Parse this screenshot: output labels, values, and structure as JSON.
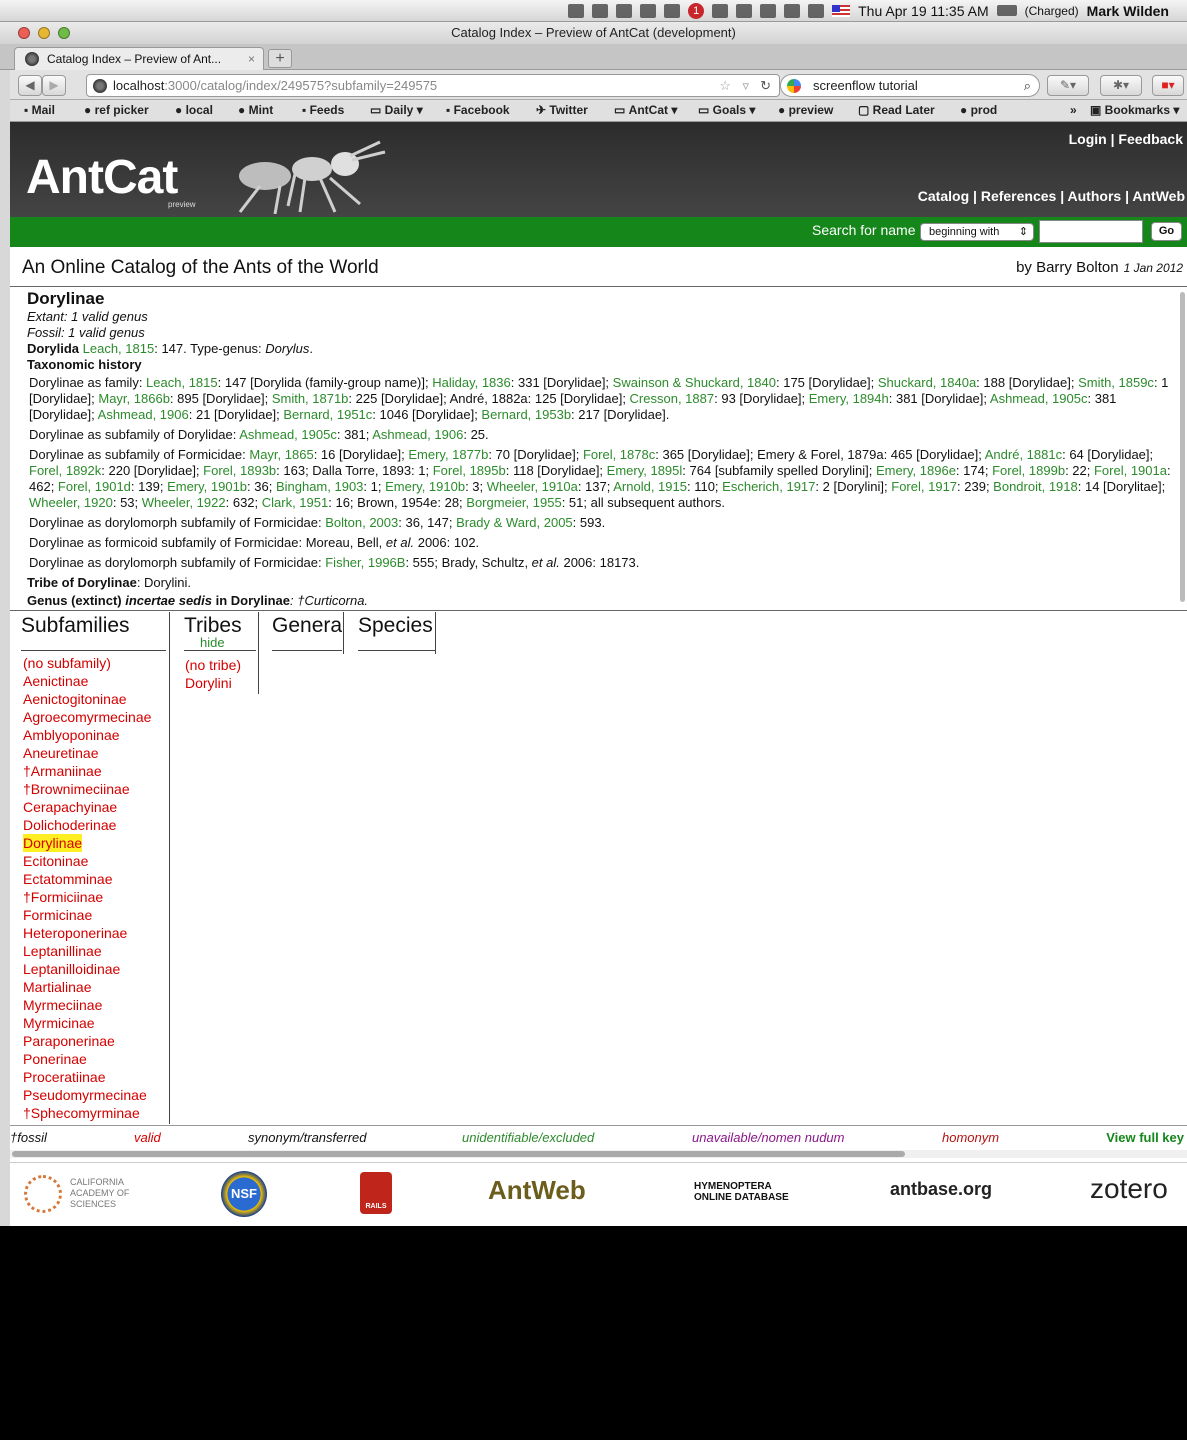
{
  "menubar": {
    "datetime": "Thu Apr 19  11:35 AM",
    "battery": "(Charged)",
    "user": "Mark Wilden",
    "badge": "1"
  },
  "window": {
    "title": "Catalog Index – Preview of AntCat (development)",
    "tab_label": "Catalog Index – Preview of Ant...",
    "newtab_label": "+",
    "url_host": "localhost",
    "url_rest": ":3000/catalog/index/249575?subfamily=249575",
    "search_query": "screenflow tutorial"
  },
  "bookmarks": [
    "Mail",
    "ref picker",
    "local",
    "Mint",
    "Feeds",
    "Daily",
    "Facebook",
    "Twitter",
    "AntCat",
    "Goals",
    "preview",
    "Read Later",
    "prod",
    "Bookmarks"
  ],
  "site": {
    "logo": "AntCat",
    "logo_sub": "preview",
    "login": "Login",
    "feedback": "Feedback",
    "nav": [
      "Catalog",
      "References",
      "Authors",
      "AntWeb"
    ],
    "search_label": "Search for name",
    "search_mode": "beginning with",
    "go": "Go",
    "title": "An Online Catalog of the Ants of the World",
    "by": "by Barry Bolton",
    "date": "1 Jan 2012"
  },
  "taxon": {
    "name": "Dorylinae",
    "extant": "Extant: 1 valid genus",
    "fossil": "Fossil: 1 valid genus",
    "type_name": "Dorylida",
    "type_ref": "Leach, 1815",
    "type_tail": ": 147. Type-genus: ",
    "type_genus": "Dorylus",
    "history_heading": "Taxonomic history",
    "tribe_label": "Tribe of Dorylinae",
    "tribe_value": ": Dorylini.",
    "genus_label_a": "Genus (extinct) ",
    "genus_label_i": "incertae sedis",
    "genus_label_b": " in Dorylinae",
    "genus_value": ": †Curticorna."
  },
  "columns": {
    "subfamilies": "Subfamilies",
    "tribes": "Tribes",
    "tribes_hide": "hide",
    "genera": "Genera",
    "species": "Species"
  },
  "subfamilies": [
    "(no subfamily)",
    "Aenictinae",
    "Aenictogitoninae",
    "Agroecomyrmecinae",
    "Amblyoponinae",
    "Aneuretinae",
    "†Armaniinae",
    "†Brownimeciinae",
    "Cerapachyinae",
    "Dolichoderinae",
    "Dorylinae",
    "Ecitoninae",
    "Ectatomminae",
    "†Formiciinae",
    "Formicinae",
    "Heteroponerinae",
    "Leptanillinae",
    "Leptanilloidinae",
    "Martialinae",
    "Myrmeciinae",
    "Myrmicinae",
    "Paraponerinae",
    "Ponerinae",
    "Proceratiinae",
    "Pseudomyrmecinae",
    "†Sphecomyrminae"
  ],
  "selected_subfamily": "Dorylinae",
  "tribes": [
    "(no tribe)",
    "Dorylini"
  ],
  "legend": {
    "fossil": "†fossil",
    "valid": "valid",
    "synonym": "synonym/transferred",
    "unidentifiable": "unidentifiable/excluded",
    "unavailable": "unavailable/nomen nudum",
    "homonym": "homonym",
    "view_full_key": "View full key"
  },
  "footer": {
    "cas": "CALIFORNIA ACADEMY OF SCIENCES",
    "nsf": "NSF",
    "rails": "RAILS",
    "antweb": "AntWeb",
    "hol": "HYMENOPTERA ONLINE DATABASE",
    "antbase": "antbase.org",
    "zotero": "zotero"
  },
  "colors": {
    "header": "#333333",
    "green_bar": "#15871a",
    "link_green": "#2c8b2c",
    "valid_red": "#d40000",
    "highlight": "#ffee22"
  }
}
